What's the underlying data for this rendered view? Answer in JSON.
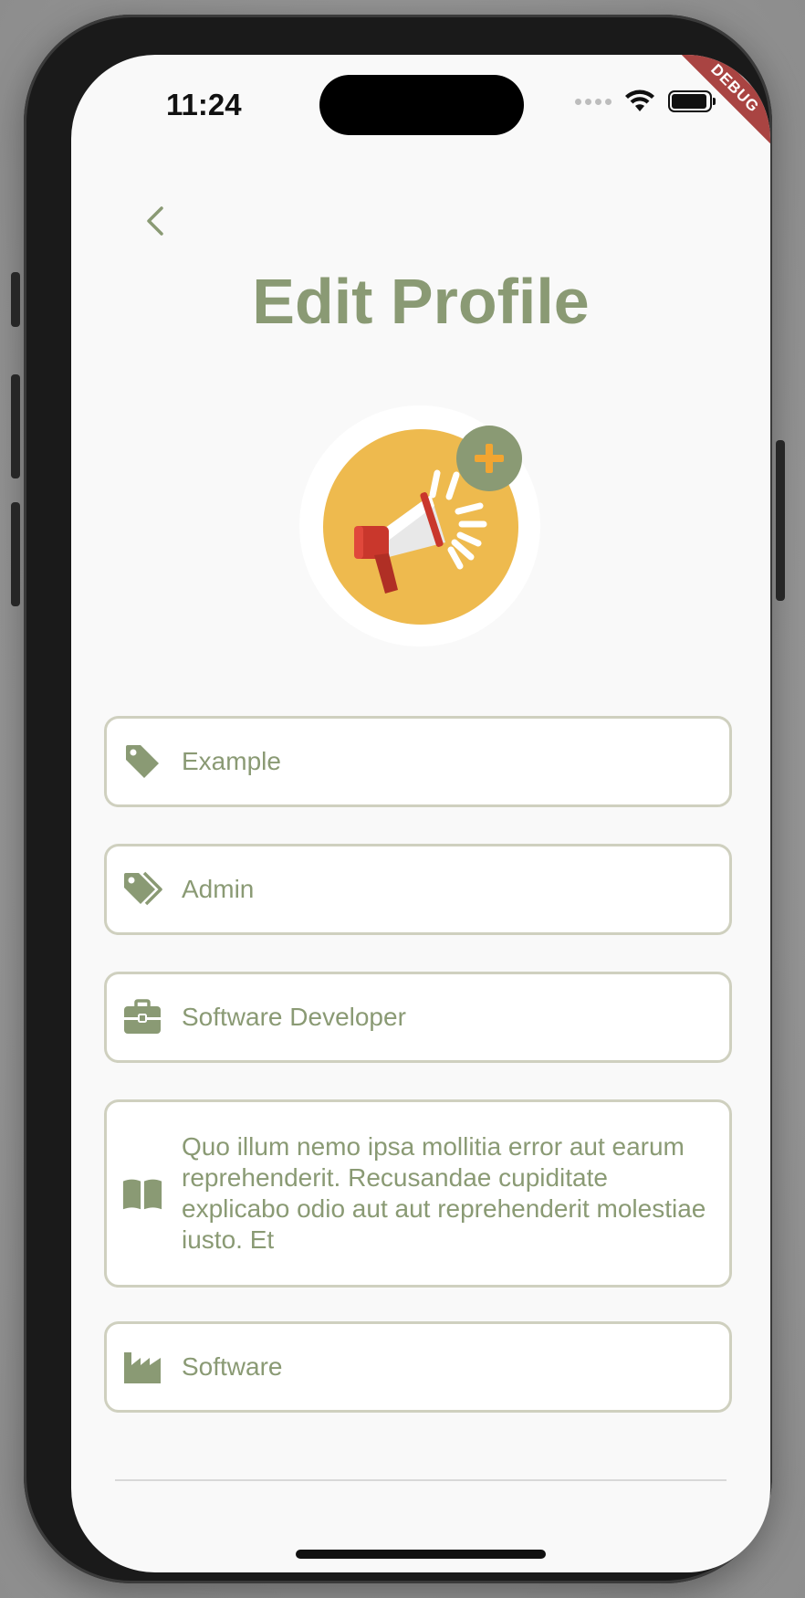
{
  "status_bar": {
    "time": "11:24"
  },
  "debug_banner": "DEBUG",
  "header": {
    "title": "Edit Profile"
  },
  "fields": {
    "name": {
      "value": "Example",
      "icon": "tag-icon"
    },
    "role": {
      "value": "Admin",
      "icon": "tags-icon"
    },
    "job": {
      "value": "Software Developer",
      "icon": "briefcase-icon"
    },
    "bio": {
      "value": "Quo illum nemo ipsa mollitia error aut earum reprehenderit. Recusandae cupiditate explicabo odio aut aut reprehenderit molestiae iusto. Et",
      "icon": "book-icon"
    },
    "industry": {
      "value": "Software",
      "icon": "factory-icon"
    }
  },
  "colors": {
    "accent": "#8a9a74",
    "field_border": "#cfd0bf",
    "avatar_bg": "#eeba4e",
    "plus": "#f2a531"
  }
}
